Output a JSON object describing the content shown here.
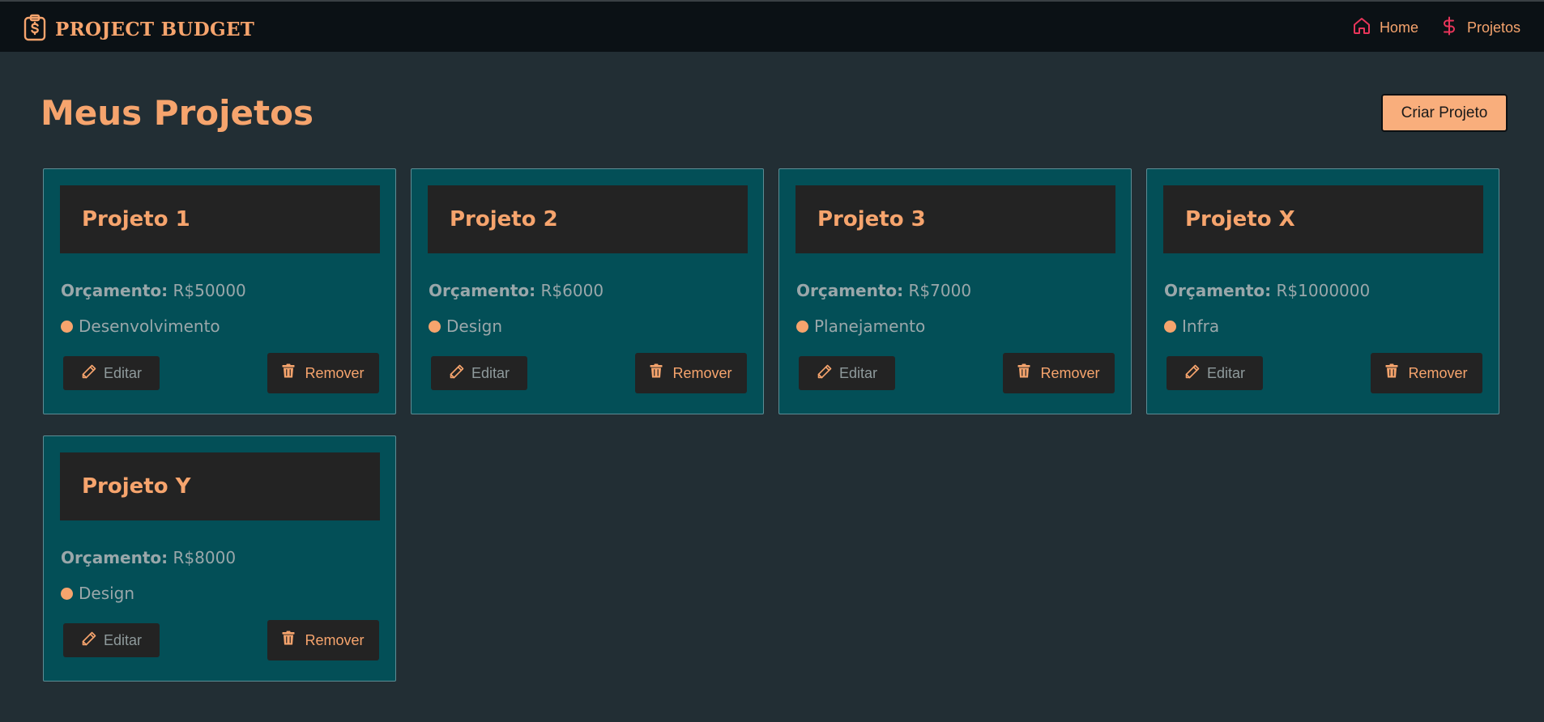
{
  "nav": {
    "brand": "PROJECT BUDGET",
    "brand_icon": "clipboard-dollar-icon",
    "links": [
      {
        "label": "Home",
        "icon": "home-icon"
      },
      {
        "label": "Projetos",
        "icon": "dollar-icon"
      }
    ]
  },
  "main": {
    "title": "Meus Projetos",
    "create_label": "Criar Projeto"
  },
  "projects": [
    {
      "name": "Projeto 1",
      "budget_label": "Orçamento:",
      "budget": "R$50000",
      "category": "Desenvolvimento",
      "edit_label": "Editar",
      "remove_label": "Remover"
    },
    {
      "name": "Projeto 2",
      "budget_label": "Orçamento:",
      "budget": "R$6000",
      "category": "Design",
      "edit_label": "Editar",
      "remove_label": "Remover"
    },
    {
      "name": "Projeto 3",
      "budget_label": "Orçamento:",
      "budget": "R$7000",
      "category": "Planejamento",
      "edit_label": "Editar",
      "remove_label": "Remover"
    },
    {
      "name": "Projeto X",
      "budget_label": "Orçamento:",
      "budget": "R$1000000",
      "category": "Infra",
      "edit_label": "Editar",
      "remove_label": "Remover"
    },
    {
      "name": "Projeto Y",
      "budget_label": "Orçamento:",
      "budget": "R$8000",
      "category": "Design",
      "edit_label": "Editar",
      "remove_label": "Remover"
    }
  ],
  "colors": {
    "accent": "#f6a46d",
    "nav_icon": "#e8355a",
    "card_bg": "#034f57",
    "page_bg": "#222e34"
  }
}
